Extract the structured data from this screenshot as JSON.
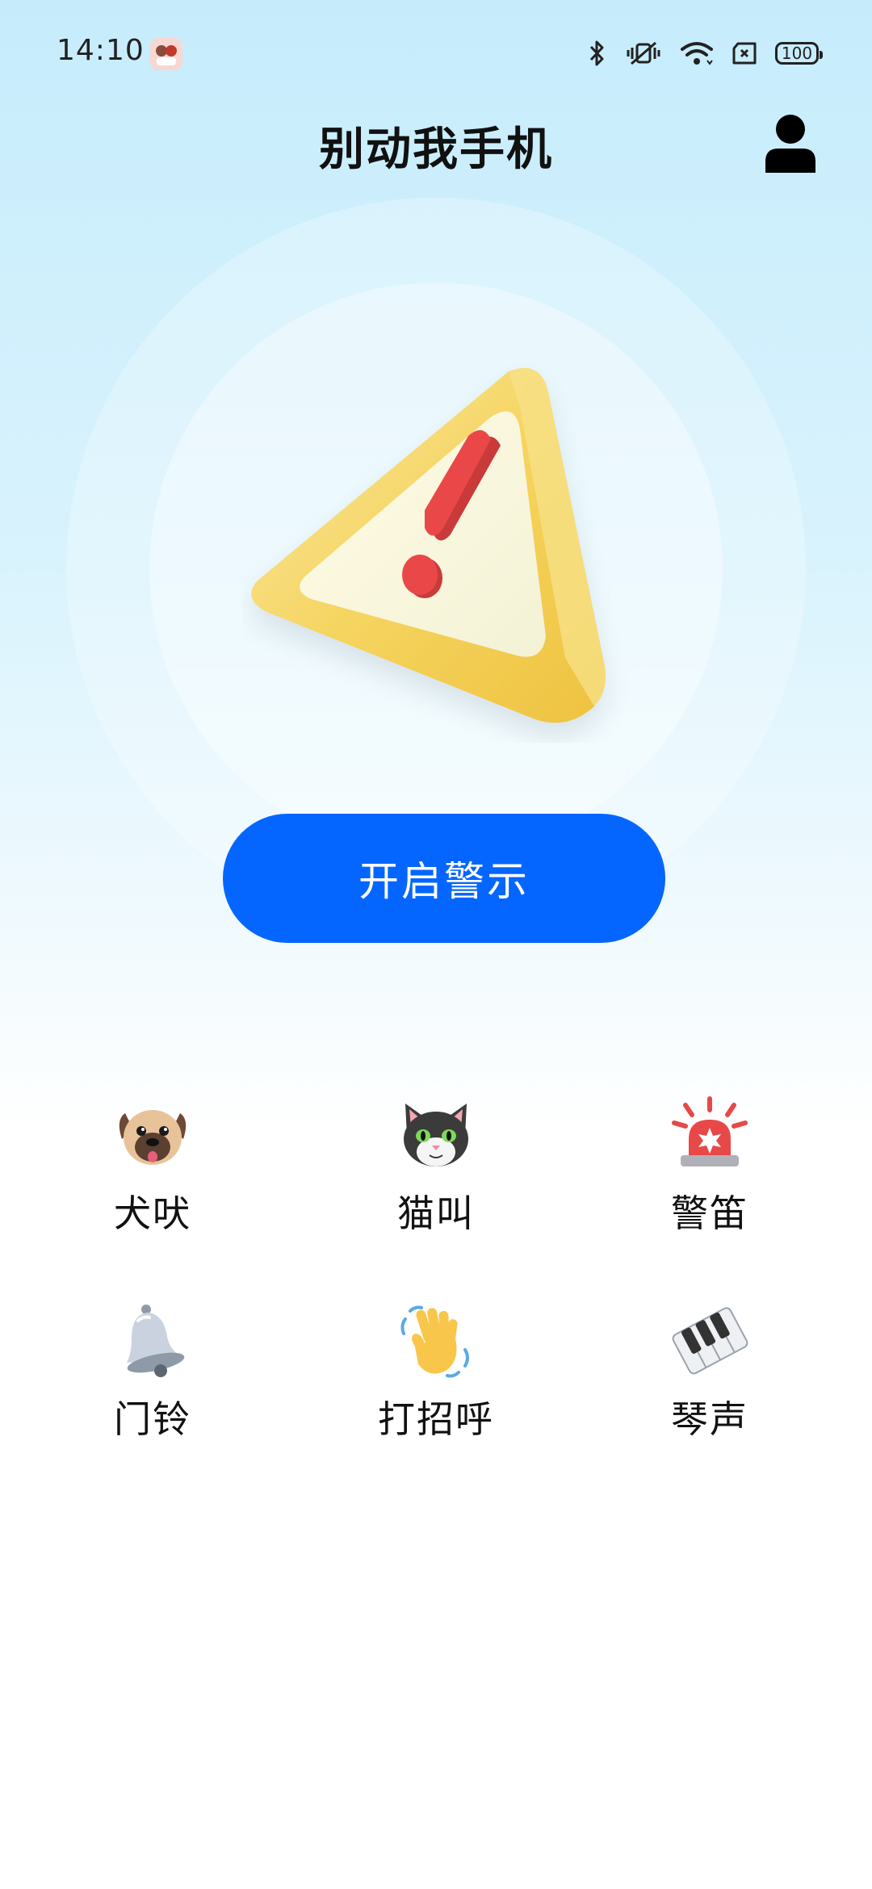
{
  "status_bar": {
    "time": "14:10",
    "battery": "100"
  },
  "header": {
    "title": "别动我手机"
  },
  "main": {
    "start_button_label": "开启警示"
  },
  "sounds": [
    {
      "label": "犬吠",
      "icon": "pug-dog-icon"
    },
    {
      "label": "猫叫",
      "icon": "cat-face-icon"
    },
    {
      "label": "警笛",
      "icon": "police-siren-icon"
    },
    {
      "label": "门铃",
      "icon": "bell-icon"
    },
    {
      "label": "打招呼",
      "icon": "waving-hand-icon"
    },
    {
      "label": "琴声",
      "icon": "piano-keys-icon"
    }
  ],
  "colors": {
    "primary": "#0466ff",
    "background_top": "#c6ecfc",
    "warning_yellow": "#f2c94c",
    "warning_red": "#e84848"
  }
}
